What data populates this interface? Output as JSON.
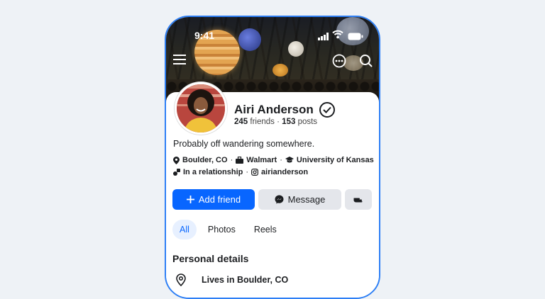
{
  "status_bar": {
    "time": "9:41"
  },
  "profile": {
    "name": "Airi Anderson",
    "friends_count": "245",
    "friends_label": "friends",
    "separator": "·",
    "posts_count": "153",
    "posts_label": "posts",
    "bio": "Probably off wandering somewhere.",
    "location": "Boulder, CO",
    "work": "Walmart",
    "school": "University of Kansas",
    "relationship": "In a relationship",
    "instagram": "airianderson"
  },
  "actions": {
    "add_friend": "Add friend",
    "message": "Message"
  },
  "tabs": [
    {
      "label": "All",
      "active": true
    },
    {
      "label": "Photos",
      "active": false
    },
    {
      "label": "Reels",
      "active": false
    }
  ],
  "personal_details": {
    "title": "Personal details",
    "lives_in": "Lives in Boulder, CO"
  },
  "colors": {
    "accent": "#0866ff",
    "frame": "#2d7ff5",
    "button_gray": "#e4e6eb"
  }
}
